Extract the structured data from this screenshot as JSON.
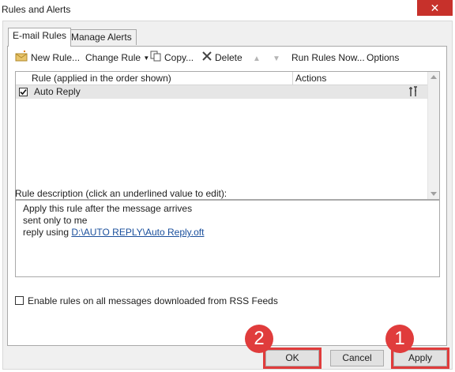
{
  "window": {
    "title": "Rules and Alerts",
    "close_glyph": "✕"
  },
  "tabs": [
    {
      "label": "E-mail Rules",
      "active": true
    },
    {
      "label": "Manage Alerts",
      "active": false
    }
  ],
  "toolbar": {
    "new_rule": "New Rule...",
    "change_rule": "Change Rule",
    "copy": "Copy...",
    "delete": "Delete",
    "run_rules_now": "Run Rules Now...",
    "options": "Options"
  },
  "rules_list": {
    "columns": [
      "Rule (applied in the order shown)",
      "Actions"
    ],
    "rows": [
      {
        "name": "Auto Reply",
        "checked": true
      }
    ]
  },
  "description": {
    "label": "Rule description (click an underlined value to edit):",
    "line1": "Apply this rule after the message arrives",
    "line2": "sent only to me",
    "line3_prefix": "reply using ",
    "line3_link": "D:\\AUTO REPLY\\Auto Reply.oft"
  },
  "rss": {
    "label": "Enable rules on all messages downloaded from RSS Feeds",
    "checked": false
  },
  "buttons": {
    "ok": "OK",
    "cancel": "Cancel",
    "apply": "Apply"
  },
  "markers": {
    "apply_step": "1",
    "ok_step": "2"
  },
  "colors": {
    "highlight": "#e03c3c",
    "close_button": "#c7312b",
    "link": "#1a4f9c"
  }
}
